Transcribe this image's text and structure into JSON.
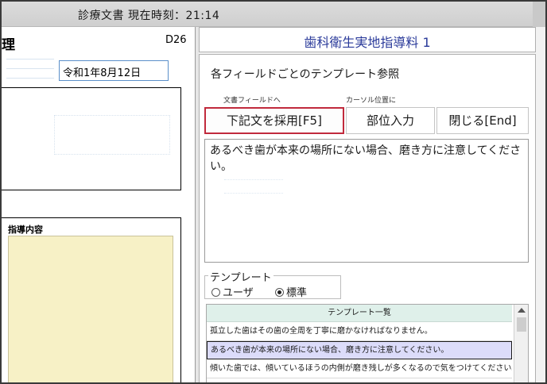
{
  "window": {
    "title": "診療文書 現在時刻：21:14"
  },
  "document": {
    "header_partial": "理",
    "code": "D26",
    "date": "令和1年8月12日",
    "section_label": "指導内容"
  },
  "panel": {
    "header_title": "歯科衛生実地指導料 1",
    "section_title": "各フィールドごとのテンプレート参照",
    "small_label_doc": "文書フィールドへ",
    "small_label_cursor": "カーソル位置に",
    "buttons": {
      "adopt": "下記文を採用[F5]",
      "part_input": "部位入力",
      "close": "閉じる[End]"
    },
    "text_content": "あるべき歯が本来の場所にない場合、磨き方に注意してください。",
    "template_group": {
      "legend": "テンプレート",
      "options": [
        "ユーザ",
        "標準"
      ],
      "selected": "標準"
    },
    "list": {
      "header": "テンプレート一覧",
      "rows": [
        "孤立した歯はその歯の全周を丁寧に磨かなければなりません。",
        "あるべき歯が本来の場所にない場合、磨き方に注意してください。",
        "傾いた歯では、傾いているほうの内側が磨き残しが多くなるので気をつけてください。"
      ],
      "selected_index": 1
    }
  }
}
